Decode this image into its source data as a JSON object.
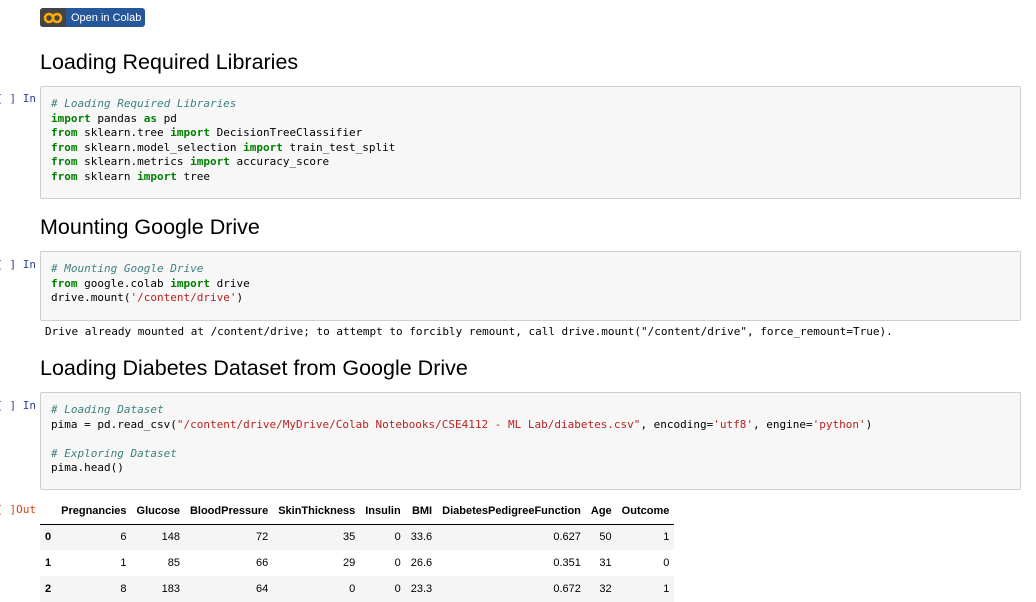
{
  "badge": {
    "label": "Open in Colab"
  },
  "sections": {
    "s1": "Loading Required Libraries",
    "s2": "Mounting Google Drive",
    "s3": "Loading Diabetes Dataset from Google Drive"
  },
  "prompts": {
    "in": "In [ ]:",
    "out": "Out[ ]:"
  },
  "cell1": {
    "comment": "# Loading Required Libraries",
    "l1": [
      "import",
      " pandas ",
      "as",
      " pd"
    ],
    "l2": [
      "from",
      " sklearn.tree ",
      "import",
      " DecisionTreeClassifier"
    ],
    "l3": [
      "from",
      " sklearn.model_selection ",
      "import",
      " train_test_split"
    ],
    "l4": [
      "from",
      " sklearn.metrics ",
      "import",
      " accuracy_score"
    ],
    "l5": [
      "from",
      " sklearn ",
      "import",
      " tree"
    ]
  },
  "cell2": {
    "comment": "# Mounting Google Drive",
    "l1": [
      "from",
      " google.colab ",
      "import",
      " drive"
    ],
    "l2a": "drive.mount(",
    "l2s": "'/content/drive'",
    "l2b": ")"
  },
  "output2": "Drive already mounted at /content/drive; to attempt to forcibly remount, call drive.mount(\"/content/drive\", force_remount=True).",
  "cell3": {
    "comment1": "# Loading Dataset",
    "l1a": "pima = pd.read_csv(",
    "l1s1": "\"/content/drive/MyDrive/Colab Notebooks/CSE4112 - ML Lab/diabetes.csv\"",
    "l1b": ", encoding=",
    "l1s2": "'utf8'",
    "l1c": ", engine=",
    "l1s3": "'python'",
    "l1d": ")",
    "comment2": "# Exploring Dataset",
    "l2": "pima.head()"
  },
  "table": {
    "columns": [
      "",
      "Pregnancies",
      "Glucose",
      "BloodPressure",
      "SkinThickness",
      "Insulin",
      "BMI",
      "DiabetesPedigreeFunction",
      "Age",
      "Outcome"
    ],
    "rows": [
      [
        "0",
        "6",
        "148",
        "72",
        "35",
        "0",
        "33.6",
        "0.627",
        "50",
        "1"
      ],
      [
        "1",
        "1",
        "85",
        "66",
        "29",
        "0",
        "26.6",
        "0.351",
        "31",
        "0"
      ],
      [
        "2",
        "8",
        "183",
        "64",
        "0",
        "0",
        "23.3",
        "0.672",
        "32",
        "1"
      ]
    ]
  },
  "colors": {
    "keyword": "#008000",
    "comment": "#408080",
    "string": "#ba2121",
    "badge": "#26579b"
  }
}
